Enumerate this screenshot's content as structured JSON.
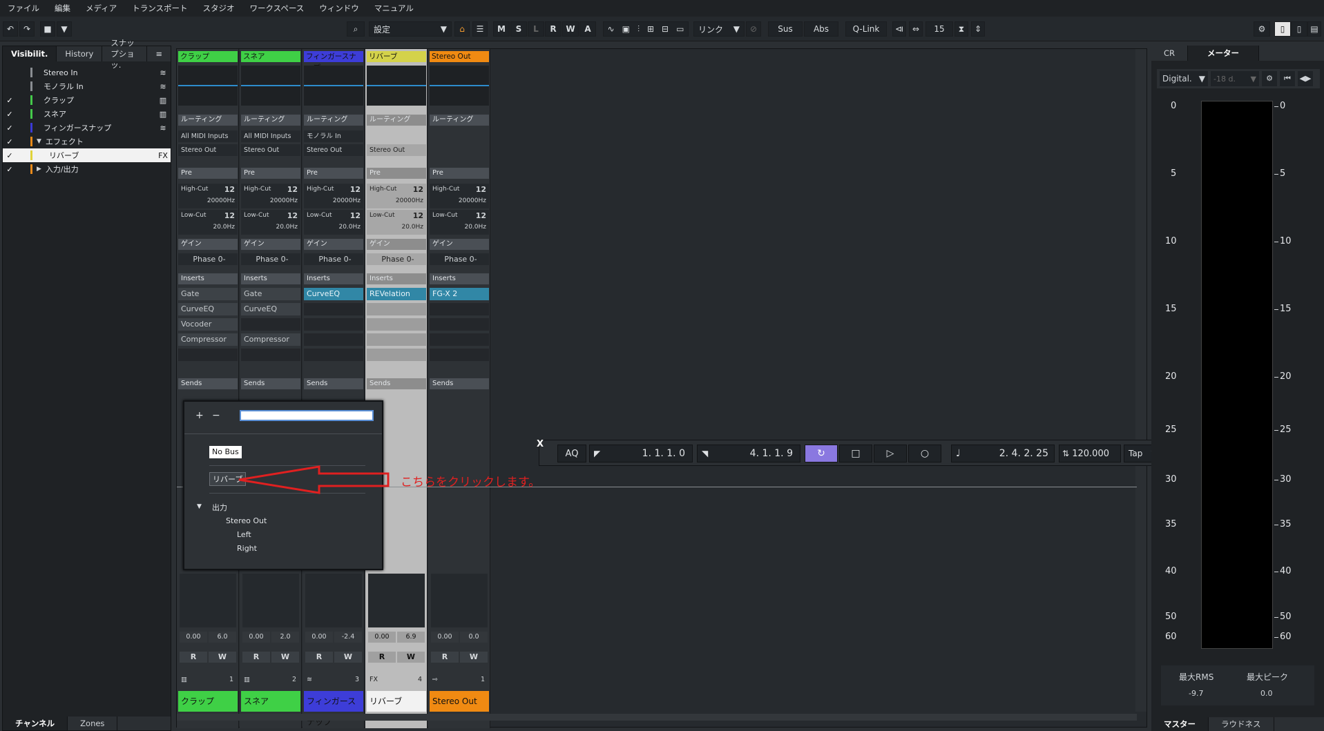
{
  "menu": [
    "ファイル",
    "編集",
    "メディア",
    "トランスポート",
    "スタジオ",
    "ワークスペース",
    "ウィンドウ",
    "マニュアル"
  ],
  "toolbar": {
    "preset": "設定",
    "buttons": [
      "M",
      "S",
      "L",
      "R",
      "W",
      "A"
    ],
    "link": "リンク",
    "sus": "Sus",
    "abs": "Abs",
    "qlink": "Q-Link",
    "number": "15"
  },
  "left_panel": {
    "tabs": [
      "Visibilit.",
      "History",
      "スナップショッ."
    ],
    "menu_icon": "≡",
    "rows": [
      {
        "label": "Stereo In",
        "check": "",
        "color": "#8a8e92",
        "icon": "≋",
        "indent": 0
      },
      {
        "label": "モノラル In",
        "check": "",
        "color": "#8a8e92",
        "icon": "≋",
        "indent": 0
      },
      {
        "label": "クラップ",
        "check": "✓",
        "color": "#44c94a",
        "icon": "▥",
        "indent": 0
      },
      {
        "label": "スネア",
        "check": "✓",
        "color": "#44c94a",
        "icon": "▥",
        "indent": 0
      },
      {
        "label": "フィンガースナップ",
        "check": "✓",
        "color": "#3a3ad6",
        "icon": "≋",
        "indent": 0
      },
      {
        "label": "エフェクト",
        "check": "✓",
        "color": "#e88a1a",
        "icon": "",
        "indent": 1
      },
      {
        "label": "リバーブ",
        "check": "✓",
        "color": "#e0d33a",
        "icon": "FX",
        "indent": 2
      },
      {
        "label": "入力/出力",
        "check": "✓",
        "color": "#e88a1a",
        "icon": "",
        "indent": 1
      }
    ],
    "bottom_tabs": [
      "チャンネル",
      "Zones"
    ]
  },
  "strips": [
    {
      "name": "クラップ",
      "color": "#3fd046",
      "routing": "ルーティング",
      "in": "All MIDI Inputs",
      "out": "Stereo Out",
      "inserts": [
        "Gate",
        "CurveEQ",
        "Vocoder",
        "Compressor"
      ],
      "vol": "0.00",
      "pan": "6.0",
      "num": "1",
      "type": "▥"
    },
    {
      "name": "スネア",
      "color": "#3fd046",
      "routing": "ルーティング",
      "in": "All MIDI Inputs",
      "out": "Stereo Out",
      "inserts": [
        "Gate",
        "CurveEQ",
        "",
        "Compressor"
      ],
      "vol": "0.00",
      "pan": "2.0",
      "num": "2",
      "type": "▥"
    },
    {
      "name": "フィンガースナップ",
      "color": "#3d3dd8",
      "routing": "ルーティング",
      "in": "モノラル In",
      "out": "Stereo Out",
      "inserts": [
        "CurveEQ",
        "",
        "",
        ""
      ],
      "vol": "0.00",
      "pan": "-2.4",
      "num": "3",
      "type": "≋"
    },
    {
      "name": "リバーブ",
      "color": "#d4d24a",
      "routing": "ルーティング",
      "in": "",
      "out": "Stereo Out",
      "inserts": [
        "REVelation",
        "",
        "",
        ""
      ],
      "vol": "0.00",
      "pan": "6.9",
      "num": "4",
      "type": "FX"
    },
    {
      "name": "Stereo Out",
      "color": "#f08a12",
      "routing": "ルーティング",
      "in": "",
      "out": "",
      "inserts": [
        "FG-X 2",
        "",
        "",
        ""
      ],
      "vol": "0.00",
      "pan": "0.0",
      "num": "1",
      "type": "⇨"
    }
  ],
  "strip_labels": {
    "pre": "Pre",
    "highcut": "High-Cut",
    "highcut_val": "20000Hz",
    "lowcut": "Low-Cut",
    "lowcut_val": "20.0Hz",
    "slope": "12",
    "gain": "ゲイン",
    "phase": "Phase 0-",
    "inserts": "Inserts",
    "sends": "Sends",
    "r": "R",
    "w": "W"
  },
  "popup": {
    "plus": "+",
    "minus": "−",
    "nobus": "No Bus",
    "reverb": "リバーブ",
    "output": "出力",
    "stereo_out": "Stereo Out",
    "left": "Left",
    "right": "Right"
  },
  "annotation": "こちらをクリックします。",
  "transport": {
    "aq": "AQ",
    "left_locator": "1. 1. 1.   0",
    "right_locator": "4. 1. 1.   9",
    "position": "2. 4. 2. 25",
    "tempo": "120.000",
    "tap": "Tap",
    "close": "X"
  },
  "right_panel": {
    "tabs": [
      "CR",
      "メーター"
    ],
    "select": "Digital.",
    "ref": "-18 d.",
    "scale": [
      "0",
      "5",
      "10",
      "15",
      "20",
      "25",
      "30",
      "35",
      "40",
      "50",
      "60"
    ],
    "max_rms_label": "最大RMS",
    "max_peak_label": "最大ピーク",
    "max_rms": "-9.7",
    "max_peak": "0.0",
    "bottom_tabs": [
      "マスター",
      "ラウドネス"
    ]
  }
}
